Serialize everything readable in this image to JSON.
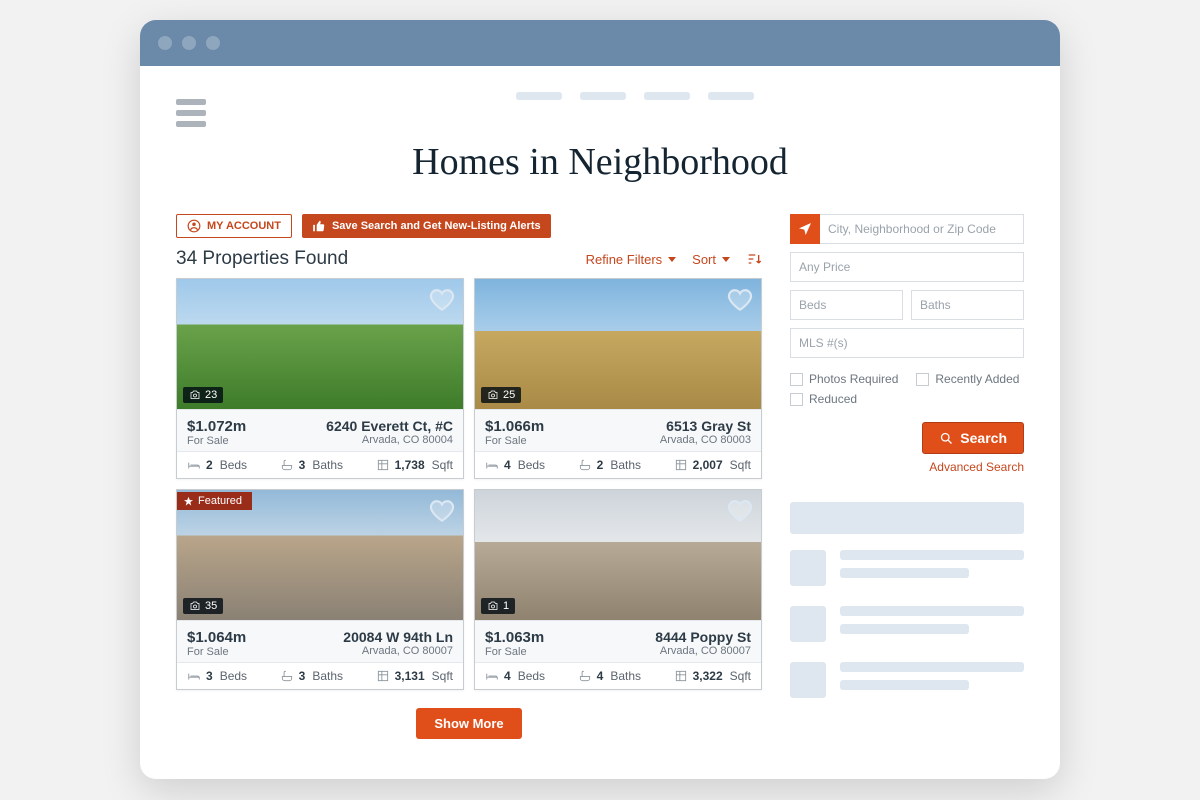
{
  "page": {
    "title": "Homes in Neighborhood"
  },
  "toolbar": {
    "my_account_label": "MY ACCOUNT",
    "save_search_label": "Save Search and Get New-Listing Alerts"
  },
  "results": {
    "count_label": "34 Properties Found",
    "refine_label": "Refine Filters",
    "sort_label": "Sort",
    "show_more_label": "Show More"
  },
  "listings": [
    {
      "photo_count": "23",
      "featured": false,
      "price": "$1.072m",
      "status": "For Sale",
      "address": "6240 Everett Ct, #C",
      "city": "Arvada, CO 80004",
      "beds": "2",
      "beds_label": "Beds",
      "baths": "3",
      "baths_label": "Baths",
      "sqft": "1,738",
      "sqft_label": "Sqft",
      "scene": "lawn"
    },
    {
      "photo_count": "25",
      "featured": false,
      "price": "$1.066m",
      "status": "For Sale",
      "address": "6513 Gray St",
      "city": "Arvada, CO 80003",
      "beds": "4",
      "beds_label": "Beds",
      "baths": "2",
      "baths_label": "Baths",
      "sqft": "2,007",
      "sqft_label": "Sqft",
      "scene": "field"
    },
    {
      "photo_count": "35",
      "featured": true,
      "featured_label": "Featured",
      "price": "$1.064m",
      "status": "For Sale",
      "address": "20084 W 94th Ln",
      "city": "Arvada, CO 80007",
      "beds": "3",
      "beds_label": "Beds",
      "baths": "3",
      "baths_label": "Baths",
      "sqft": "3,131",
      "sqft_label": "Sqft",
      "scene": "building"
    },
    {
      "photo_count": "1",
      "featured": false,
      "price": "$1.063m",
      "status": "For Sale",
      "address": "8444 Poppy St",
      "city": "Arvada, CO 80007",
      "beds": "4",
      "beds_label": "Beds",
      "baths": "4",
      "baths_label": "Baths",
      "sqft": "3,322",
      "sqft_label": "Sqft",
      "scene": "interior"
    }
  ],
  "search": {
    "location_placeholder": "City, Neighborhood or Zip Code",
    "price_placeholder": "Any Price",
    "beds_placeholder": "Beds",
    "baths_placeholder": "Baths",
    "mls_placeholder": "MLS #(s)",
    "chk_photos": "Photos Required",
    "chk_recent": "Recently Added",
    "chk_reduced": "Reduced",
    "search_label": "Search",
    "advanced_label": "Advanced Search"
  },
  "colors": {
    "accent": "#c5471e",
    "accent_bright": "#e04f1a",
    "chrome": "#6b89a8"
  }
}
